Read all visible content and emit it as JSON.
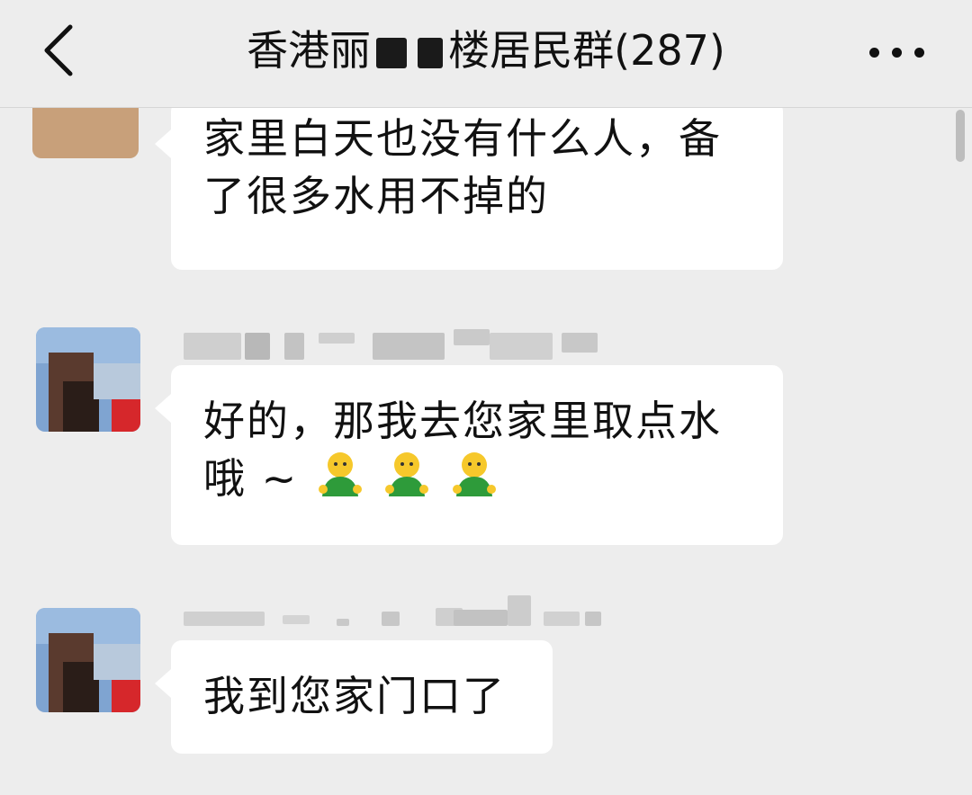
{
  "header": {
    "back_label": "<",
    "title_prefix": "香港丽",
    "title_suffix": "楼居民群(287)",
    "more_label": "..."
  },
  "messages": [
    {
      "text_line1": "家里白天也没有什么人，备",
      "text_line2": "了很多水用不掉的"
    },
    {
      "text_line1": "好的，那我去您家里取点水",
      "text_line2": "哦 ~"
    },
    {
      "text_line1": "我到您家门口了"
    }
  ],
  "colors": {
    "background": "#ededed",
    "bubble": "#ffffff",
    "text": "#111111"
  },
  "icons": {
    "back": "chevron-left-icon",
    "more": "more-dots-icon",
    "emoji": "person-emoji-icon"
  }
}
